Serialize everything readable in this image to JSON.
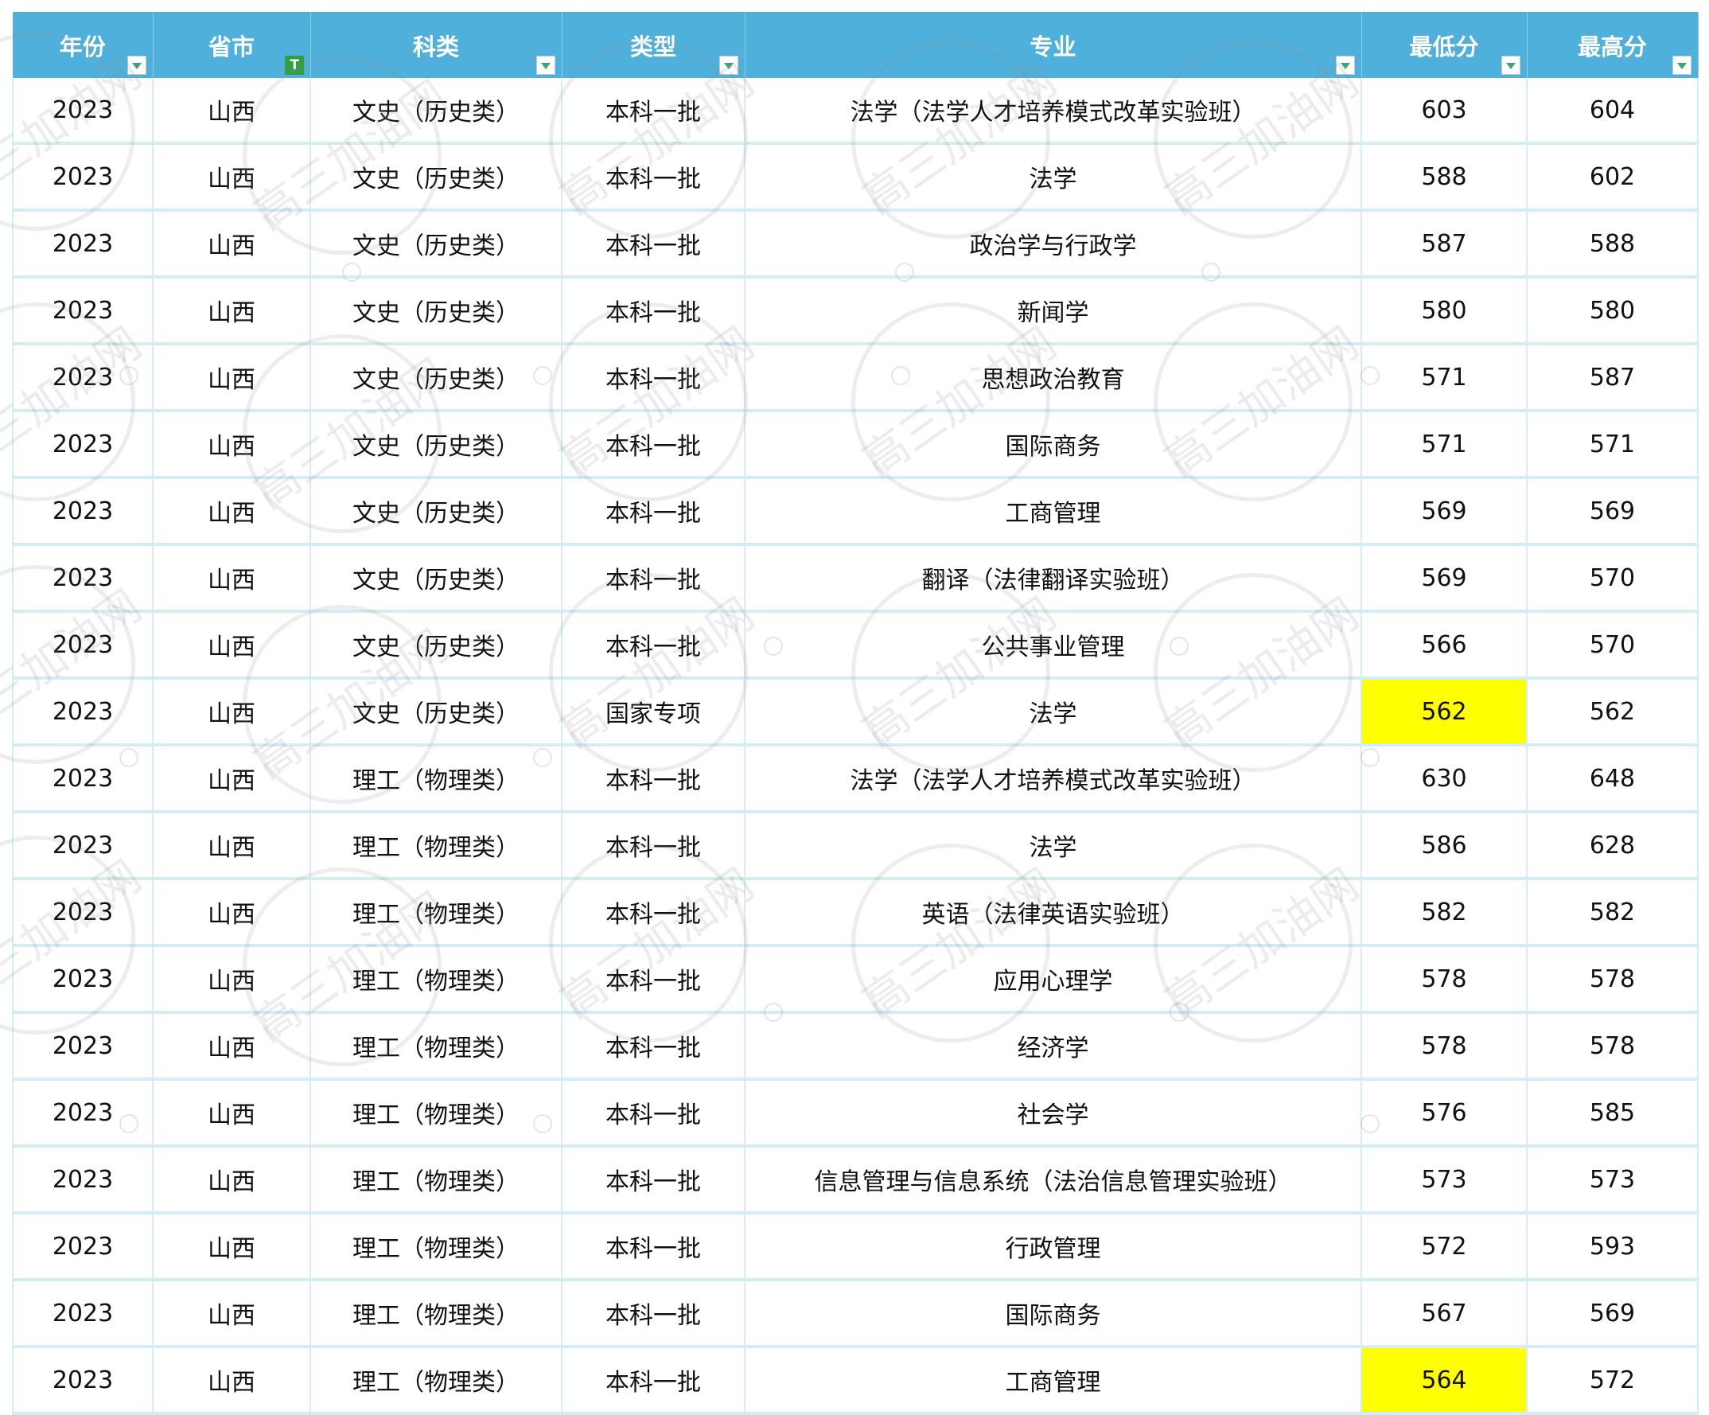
{
  "table": {
    "headers": [
      {
        "label": "年份",
        "filter_active": false
      },
      {
        "label": "省市",
        "filter_active": true
      },
      {
        "label": "科类",
        "filter_active": false
      },
      {
        "label": "类型",
        "filter_active": false
      },
      {
        "label": "专业",
        "filter_active": false
      },
      {
        "label": "最低分",
        "filter_active": false
      },
      {
        "label": "最高分",
        "filter_active": false
      }
    ],
    "rows": [
      {
        "year": "2023",
        "province": "山西",
        "category": "文史（历史类）",
        "type": "本科一批",
        "major": "法学（法学人才培养模式改革实验班）",
        "min_score": "603",
        "max_score": "604",
        "highlight_min": false
      },
      {
        "year": "2023",
        "province": "山西",
        "category": "文史（历史类）",
        "type": "本科一批",
        "major": "法学",
        "min_score": "588",
        "max_score": "602",
        "highlight_min": false
      },
      {
        "year": "2023",
        "province": "山西",
        "category": "文史（历史类）",
        "type": "本科一批",
        "major": "政治学与行政学",
        "min_score": "587",
        "max_score": "588",
        "highlight_min": false
      },
      {
        "year": "2023",
        "province": "山西",
        "category": "文史（历史类）",
        "type": "本科一批",
        "major": "新闻学",
        "min_score": "580",
        "max_score": "580",
        "highlight_min": false
      },
      {
        "year": "2023",
        "province": "山西",
        "category": "文史（历史类）",
        "type": "本科一批",
        "major": "思想政治教育",
        "min_score": "571",
        "max_score": "587",
        "highlight_min": false
      },
      {
        "year": "2023",
        "province": "山西",
        "category": "文史（历史类）",
        "type": "本科一批",
        "major": "国际商务",
        "min_score": "571",
        "max_score": "571",
        "highlight_min": false
      },
      {
        "year": "2023",
        "province": "山西",
        "category": "文史（历史类）",
        "type": "本科一批",
        "major": "工商管理",
        "min_score": "569",
        "max_score": "569",
        "highlight_min": false
      },
      {
        "year": "2023",
        "province": "山西",
        "category": "文史（历史类）",
        "type": "本科一批",
        "major": "翻译（法律翻译实验班）",
        "min_score": "569",
        "max_score": "570",
        "highlight_min": false
      },
      {
        "year": "2023",
        "province": "山西",
        "category": "文史（历史类）",
        "type": "本科一批",
        "major": "公共事业管理",
        "min_score": "566",
        "max_score": "570",
        "highlight_min": false
      },
      {
        "year": "2023",
        "province": "山西",
        "category": "文史（历史类）",
        "type": "国家专项",
        "major": "法学",
        "min_score": "562",
        "max_score": "562",
        "highlight_min": true
      },
      {
        "year": "2023",
        "province": "山西",
        "category": "理工（物理类）",
        "type": "本科一批",
        "major": "法学（法学人才培养模式改革实验班）",
        "min_score": "630",
        "max_score": "648",
        "highlight_min": false
      },
      {
        "year": "2023",
        "province": "山西",
        "category": "理工（物理类）",
        "type": "本科一批",
        "major": "法学",
        "min_score": "586",
        "max_score": "628",
        "highlight_min": false
      },
      {
        "year": "2023",
        "province": "山西",
        "category": "理工（物理类）",
        "type": "本科一批",
        "major": "英语（法律英语实验班）",
        "min_score": "582",
        "max_score": "582",
        "highlight_min": false
      },
      {
        "year": "2023",
        "province": "山西",
        "category": "理工（物理类）",
        "type": "本科一批",
        "major": "应用心理学",
        "min_score": "578",
        "max_score": "578",
        "highlight_min": false
      },
      {
        "year": "2023",
        "province": "山西",
        "category": "理工（物理类）",
        "type": "本科一批",
        "major": "经济学",
        "min_score": "578",
        "max_score": "578",
        "highlight_min": false
      },
      {
        "year": "2023",
        "province": "山西",
        "category": "理工（物理类）",
        "type": "本科一批",
        "major": "社会学",
        "min_score": "576",
        "max_score": "585",
        "highlight_min": false
      },
      {
        "year": "2023",
        "province": "山西",
        "category": "理工（物理类）",
        "type": "本科一批",
        "major": "信息管理与信息系统（法治信息管理实验班）",
        "min_score": "573",
        "max_score": "573",
        "highlight_min": false
      },
      {
        "year": "2023",
        "province": "山西",
        "category": "理工（物理类）",
        "type": "本科一批",
        "major": "行政管理",
        "min_score": "572",
        "max_score": "593",
        "highlight_min": false
      },
      {
        "year": "2023",
        "province": "山西",
        "category": "理工（物理类）",
        "type": "本科一批",
        "major": "国际商务",
        "min_score": "567",
        "max_score": "569",
        "highlight_min": false
      },
      {
        "year": "2023",
        "province": "山西",
        "category": "理工（物理类）",
        "type": "本科一批",
        "major": "工商管理",
        "min_score": "564",
        "max_score": "572",
        "highlight_min": true
      }
    ]
  },
  "watermark": {
    "text": "高三加油网"
  },
  "colors": {
    "header_bg": "#4fb0dc",
    "highlight": "#ffff00",
    "grid": "#d6ecf3",
    "filter_active": "#2ea043"
  }
}
